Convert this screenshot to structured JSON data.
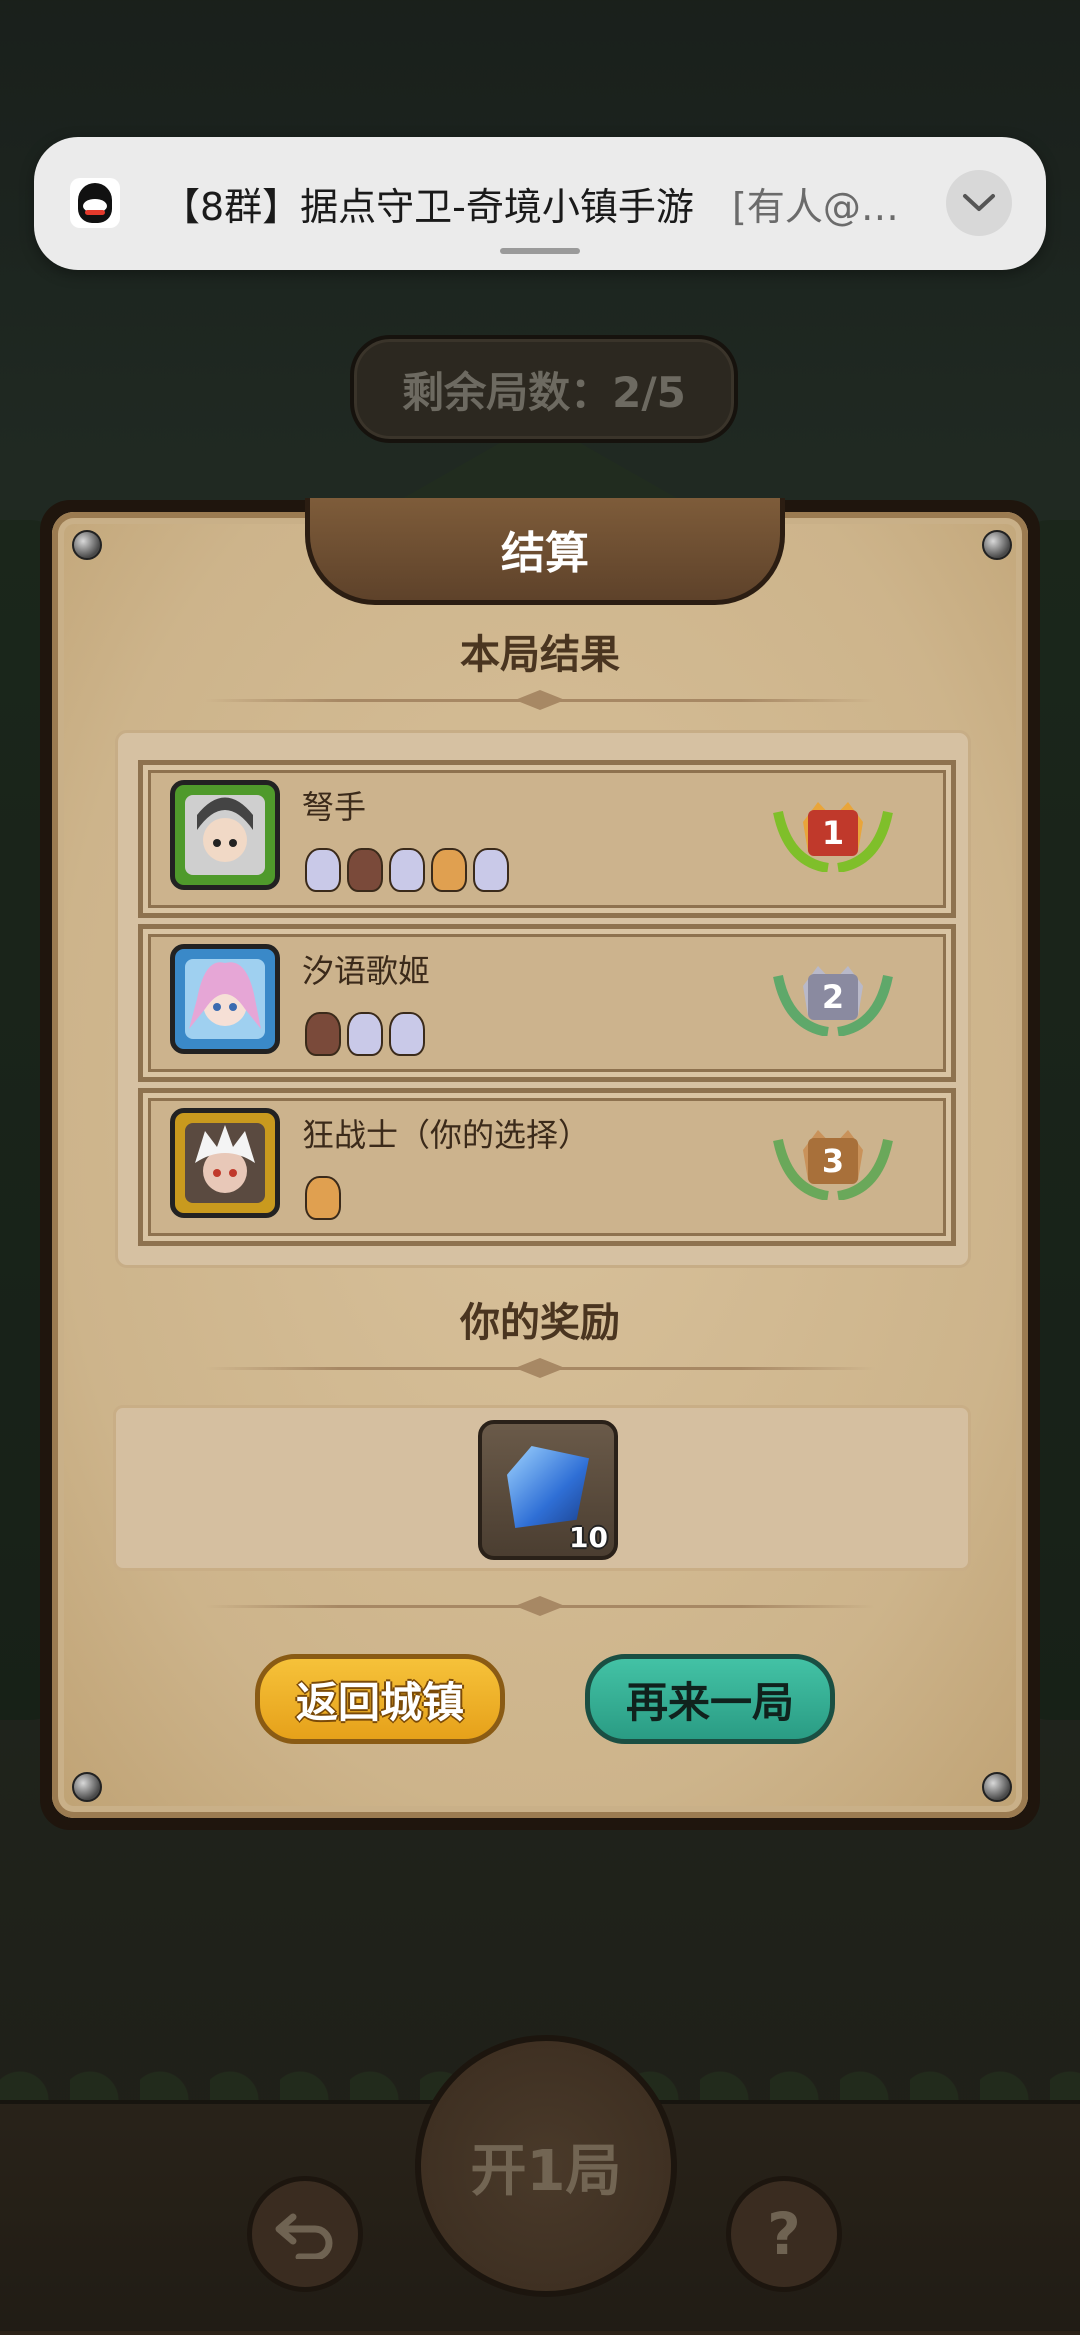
{
  "notification": {
    "app_icon": "qq-penguin-icon",
    "title": "【8群】据点守卫-奇境小镇手游",
    "preview": "[有人@…",
    "expand_icon": "chevron-down-icon"
  },
  "rounds_label": "剩余局数：2/5",
  "dialog": {
    "title": "结算",
    "results_heading": "本局结果",
    "results": [
      {
        "name": "弩手",
        "rank": "1",
        "pets": 5,
        "avatar_color": "#4f9a2b"
      },
      {
        "name": "汐语歌姬",
        "rank": "2",
        "pets": 3,
        "avatar_color": "#3a89c8"
      },
      {
        "name": "狂战士（你的选择）",
        "rank": "3",
        "pets": 1,
        "avatar_color": "#c99a1e"
      }
    ],
    "reward_heading": "你的奖励",
    "reward": {
      "icon": "blue-gem-icon",
      "count": "10"
    },
    "buttons": {
      "return_town": "返回城镇",
      "play_again": "再来一局"
    }
  },
  "bottom": {
    "start_label": "开1局",
    "back_icon": "undo-arrow-icon",
    "help_label": "?"
  },
  "colors": {
    "gold_button": "#e6a11a",
    "teal_button": "#2a9c84",
    "parchment": "#d8c19b"
  }
}
